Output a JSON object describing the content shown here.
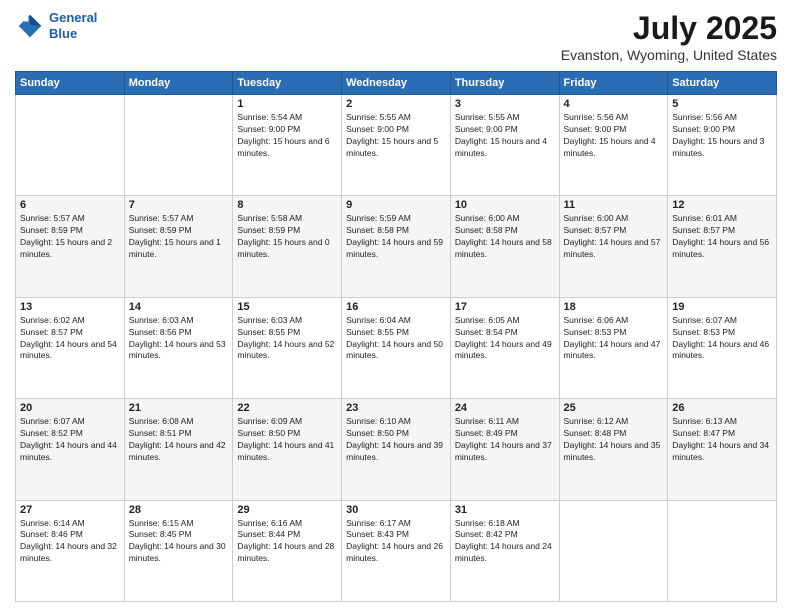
{
  "logo": {
    "line1": "General",
    "line2": "Blue"
  },
  "title": "July 2025",
  "subtitle": "Evanston, Wyoming, United States",
  "days_header": [
    "Sunday",
    "Monday",
    "Tuesday",
    "Wednesday",
    "Thursday",
    "Friday",
    "Saturday"
  ],
  "weeks": [
    [
      {
        "day": "",
        "info": ""
      },
      {
        "day": "",
        "info": ""
      },
      {
        "day": "1",
        "info": "Sunrise: 5:54 AM\nSunset: 9:00 PM\nDaylight: 15 hours and 6 minutes."
      },
      {
        "day": "2",
        "info": "Sunrise: 5:55 AM\nSunset: 9:00 PM\nDaylight: 15 hours and 5 minutes."
      },
      {
        "day": "3",
        "info": "Sunrise: 5:55 AM\nSunset: 9:00 PM\nDaylight: 15 hours and 4 minutes."
      },
      {
        "day": "4",
        "info": "Sunrise: 5:56 AM\nSunset: 9:00 PM\nDaylight: 15 hours and 4 minutes."
      },
      {
        "day": "5",
        "info": "Sunrise: 5:56 AM\nSunset: 9:00 PM\nDaylight: 15 hours and 3 minutes."
      }
    ],
    [
      {
        "day": "6",
        "info": "Sunrise: 5:57 AM\nSunset: 8:59 PM\nDaylight: 15 hours and 2 minutes."
      },
      {
        "day": "7",
        "info": "Sunrise: 5:57 AM\nSunset: 8:59 PM\nDaylight: 15 hours and 1 minute."
      },
      {
        "day": "8",
        "info": "Sunrise: 5:58 AM\nSunset: 8:59 PM\nDaylight: 15 hours and 0 minutes."
      },
      {
        "day": "9",
        "info": "Sunrise: 5:59 AM\nSunset: 8:58 PM\nDaylight: 14 hours and 59 minutes."
      },
      {
        "day": "10",
        "info": "Sunrise: 6:00 AM\nSunset: 8:58 PM\nDaylight: 14 hours and 58 minutes."
      },
      {
        "day": "11",
        "info": "Sunrise: 6:00 AM\nSunset: 8:57 PM\nDaylight: 14 hours and 57 minutes."
      },
      {
        "day": "12",
        "info": "Sunrise: 6:01 AM\nSunset: 8:57 PM\nDaylight: 14 hours and 56 minutes."
      }
    ],
    [
      {
        "day": "13",
        "info": "Sunrise: 6:02 AM\nSunset: 8:57 PM\nDaylight: 14 hours and 54 minutes."
      },
      {
        "day": "14",
        "info": "Sunrise: 6:03 AM\nSunset: 8:56 PM\nDaylight: 14 hours and 53 minutes."
      },
      {
        "day": "15",
        "info": "Sunrise: 6:03 AM\nSunset: 8:55 PM\nDaylight: 14 hours and 52 minutes."
      },
      {
        "day": "16",
        "info": "Sunrise: 6:04 AM\nSunset: 8:55 PM\nDaylight: 14 hours and 50 minutes."
      },
      {
        "day": "17",
        "info": "Sunrise: 6:05 AM\nSunset: 8:54 PM\nDaylight: 14 hours and 49 minutes."
      },
      {
        "day": "18",
        "info": "Sunrise: 6:06 AM\nSunset: 8:53 PM\nDaylight: 14 hours and 47 minutes."
      },
      {
        "day": "19",
        "info": "Sunrise: 6:07 AM\nSunset: 8:53 PM\nDaylight: 14 hours and 46 minutes."
      }
    ],
    [
      {
        "day": "20",
        "info": "Sunrise: 6:07 AM\nSunset: 8:52 PM\nDaylight: 14 hours and 44 minutes."
      },
      {
        "day": "21",
        "info": "Sunrise: 6:08 AM\nSunset: 8:51 PM\nDaylight: 14 hours and 42 minutes."
      },
      {
        "day": "22",
        "info": "Sunrise: 6:09 AM\nSunset: 8:50 PM\nDaylight: 14 hours and 41 minutes."
      },
      {
        "day": "23",
        "info": "Sunrise: 6:10 AM\nSunset: 8:50 PM\nDaylight: 14 hours and 39 minutes."
      },
      {
        "day": "24",
        "info": "Sunrise: 6:11 AM\nSunset: 8:49 PM\nDaylight: 14 hours and 37 minutes."
      },
      {
        "day": "25",
        "info": "Sunrise: 6:12 AM\nSunset: 8:48 PM\nDaylight: 14 hours and 35 minutes."
      },
      {
        "day": "26",
        "info": "Sunrise: 6:13 AM\nSunset: 8:47 PM\nDaylight: 14 hours and 34 minutes."
      }
    ],
    [
      {
        "day": "27",
        "info": "Sunrise: 6:14 AM\nSunset: 8:46 PM\nDaylight: 14 hours and 32 minutes."
      },
      {
        "day": "28",
        "info": "Sunrise: 6:15 AM\nSunset: 8:45 PM\nDaylight: 14 hours and 30 minutes."
      },
      {
        "day": "29",
        "info": "Sunrise: 6:16 AM\nSunset: 8:44 PM\nDaylight: 14 hours and 28 minutes."
      },
      {
        "day": "30",
        "info": "Sunrise: 6:17 AM\nSunset: 8:43 PM\nDaylight: 14 hours and 26 minutes."
      },
      {
        "day": "31",
        "info": "Sunrise: 6:18 AM\nSunset: 8:42 PM\nDaylight: 14 hours and 24 minutes."
      },
      {
        "day": "",
        "info": ""
      },
      {
        "day": "",
        "info": ""
      }
    ]
  ]
}
